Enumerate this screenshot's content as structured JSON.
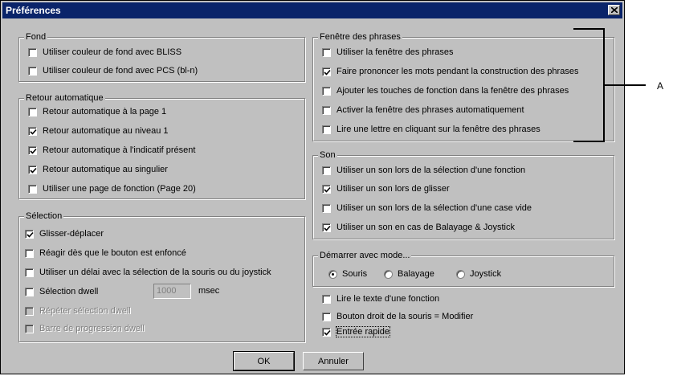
{
  "window": {
    "title": "Préférences"
  },
  "groups": {
    "fond": {
      "title": "Fond",
      "items": [
        {
          "label": "Utiliser couleur de fond avec BLISS",
          "checked": false
        },
        {
          "label": "Utiliser couleur de fond avec PCS (bl-n)",
          "checked": false
        }
      ]
    },
    "retour": {
      "title": "Retour automatique",
      "items": [
        {
          "label": "Retour automatique à la page 1",
          "checked": false
        },
        {
          "label": "Retour automatique au niveau 1",
          "checked": true
        },
        {
          "label": "Retour automatique à l'indicatif présent",
          "checked": true
        },
        {
          "label": "Retour automatique au singulier",
          "checked": true
        },
        {
          "label": "Utiliser une page de fonction (Page 20)",
          "checked": false
        }
      ]
    },
    "selection": {
      "title": "Sélection",
      "items": [
        {
          "label": "Glisser-déplacer",
          "checked": true
        },
        {
          "label": "Réagir dès que le bouton est enfoncé",
          "checked": false
        },
        {
          "label": "Utiliser un délai avec la sélection de la souris ou du joystick",
          "checked": false
        },
        {
          "label": "Sélection dwell",
          "checked": false
        },
        {
          "label": "Répéter sélection dwell",
          "checked": false,
          "disabled": true
        },
        {
          "label": "Barre de progression dwell",
          "checked": false,
          "disabled": true
        }
      ],
      "dwell_value": "1000",
      "dwell_unit": "msec"
    },
    "phrases": {
      "title": "Fenêtre des phrases",
      "items": [
        {
          "label": "Utiliser la fenêtre des phrases",
          "checked": false
        },
        {
          "label": "Faire prononcer les mots pendant la construction des phrases",
          "checked": true
        },
        {
          "label": "Ajouter les touches de fonction dans la fenêtre des phrases",
          "checked": false
        },
        {
          "label": "Activer la fenêtre des phrases automatiquement",
          "checked": false
        },
        {
          "label": "Lire une lettre en cliquant sur la fenêtre des phrases",
          "checked": false
        }
      ]
    },
    "son": {
      "title": "Son",
      "items": [
        {
          "label": "Utiliser un son lors de la sélection d'une fonction",
          "checked": false
        },
        {
          "label": "Utiliser un son lors de glisser",
          "checked": true
        },
        {
          "label": "Utiliser un son lors de la sélection d'une case vide",
          "checked": false
        },
        {
          "label": "Utiliser un son en cas de Balayage & Joystick",
          "checked": true
        }
      ]
    },
    "mode": {
      "title": "Démarrer avec mode...",
      "options": [
        {
          "label": "Souris",
          "selected": true
        },
        {
          "label": "Balayage",
          "selected": false
        },
        {
          "label": "Joystick",
          "selected": false
        }
      ]
    }
  },
  "misc": [
    {
      "label": "Lire le texte d'une fonction",
      "checked": false
    },
    {
      "label": "Bouton droit de la souris = Modifier",
      "checked": false
    },
    {
      "label": "Entrée rapide",
      "checked": true
    }
  ],
  "buttons": {
    "ok": "OK",
    "cancel": "Annuler"
  },
  "annotation": {
    "label": "A"
  }
}
